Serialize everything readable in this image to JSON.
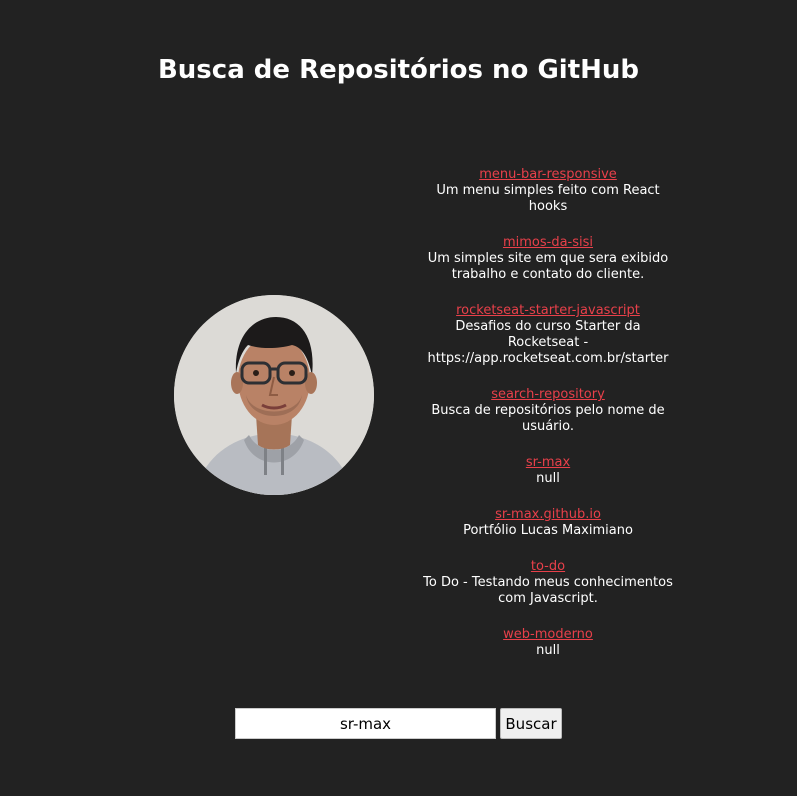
{
  "header": {
    "title": "Busca de Repositórios no GitHub"
  },
  "profile": {
    "avatar_icon": "user-photo",
    "avatar_bg": "#d9d7d3"
  },
  "repos": [
    {
      "name": "menu-bar-responsive",
      "description": "Um menu simples feito com React hooks"
    },
    {
      "name": "mimos-da-sisi",
      "description": "Um simples site em que sera exibido trabalho e contato do cliente."
    },
    {
      "name": "rocketseat-starter-javascript",
      "description": "Desafios do curso Starter da Rocketseat - https://app.rocketseat.com.br/starter"
    },
    {
      "name": "search-repository",
      "description": "Busca de repositórios pelo nome de usuário."
    },
    {
      "name": "sr-max",
      "description": "null"
    },
    {
      "name": "sr-max.github.io",
      "description": "Portfólio Lucas Maximiano"
    },
    {
      "name": "to-do",
      "description": "To Do - Testando meus conhecimentos com Javascript."
    },
    {
      "name": "web-moderno",
      "description": "null"
    }
  ],
  "search": {
    "value": "sr-max",
    "placeholder": "",
    "button_label": "Buscar"
  },
  "colors": {
    "background": "#222222",
    "link": "#e8404a",
    "text": "#ffffff"
  }
}
